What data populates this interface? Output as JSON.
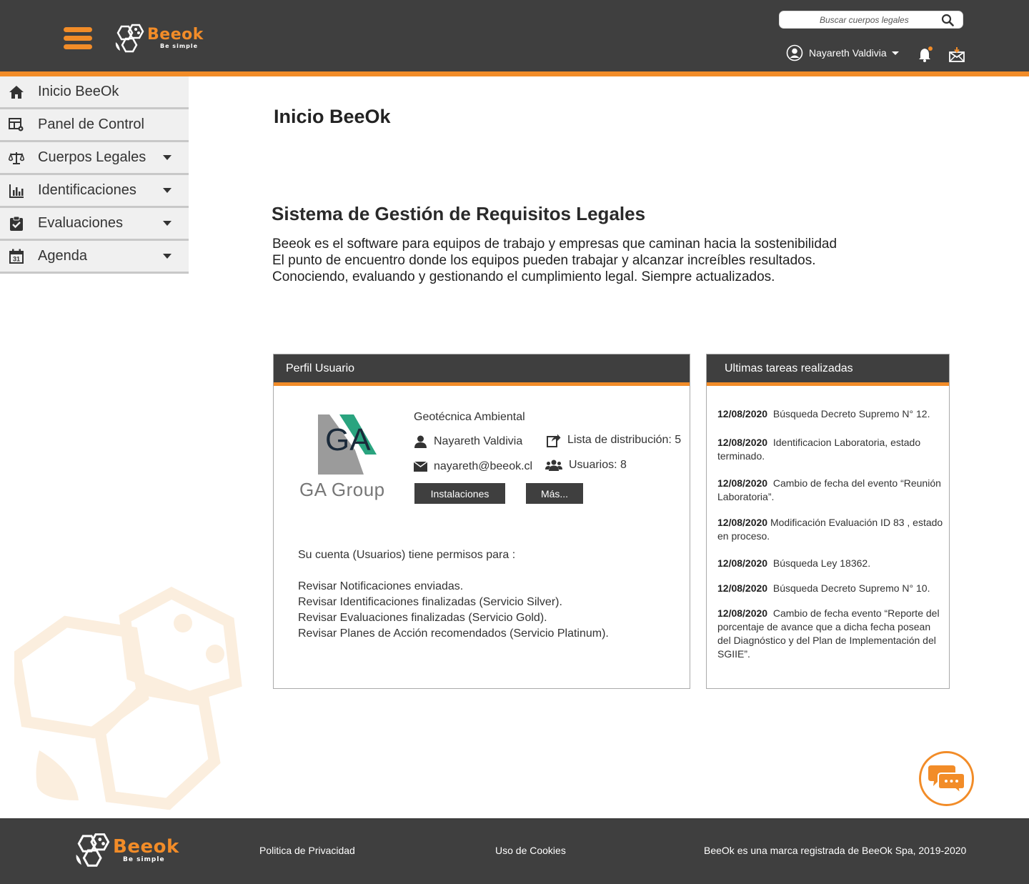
{
  "header": {
    "brand_name": "Beeok",
    "brand_tagline": "Be simple",
    "search_placeholder": "Buscar cuerpos legales",
    "user_name": "Nayareth Valdivia",
    "colors": {
      "bar": "#3f3f3f",
      "accent": "#f28c28"
    },
    "icons": [
      "menu-icon",
      "search-icon",
      "user-icon",
      "bell-icon",
      "mail-icon"
    ]
  },
  "sidebar": {
    "items": [
      {
        "label": "Inicio BeeOk",
        "icon": "home-icon",
        "has_submenu": false
      },
      {
        "label": "Panel de Control",
        "icon": "dashboard-icon",
        "has_submenu": false
      },
      {
        "label": "Cuerpos Legales",
        "icon": "scale-icon",
        "has_submenu": true
      },
      {
        "label": "Identificaciones",
        "icon": "bar-chart-icon",
        "has_submenu": true
      },
      {
        "label": "Evaluaciones",
        "icon": "clipboard-check-icon",
        "has_submenu": true
      },
      {
        "label": "Agenda",
        "icon": "calendar-icon",
        "calendar_day": "31",
        "has_submenu": true
      }
    ]
  },
  "main": {
    "page_title": "Inicio BeeOk",
    "intro_title": "Sistema de Gestión de Requisitos Legales",
    "intro_lines": [
      "Beeok es el software para equipos de trabajo y empresas que caminan hacia la sostenibilidad",
      "El punto de encuentro donde los equipos pueden trabajar y alcanzar increíbles resultados.",
      "Conociendo, evaluando y gestionando el cumplimiento legal. Siempre actualizados."
    ]
  },
  "profile": {
    "header": "Perfil Usuario",
    "logo_letters": "GA",
    "logo_text": "GA Group",
    "company": "Geotécnica Ambiental",
    "user_name": "Nayareth  Valdivia",
    "email": "nayareth@beeok.cl",
    "distribution_list": "Lista de distribución: 5",
    "users": "Usuarios: 8",
    "btn_installations": "Instalaciones",
    "btn_more": "Más...",
    "permissions_intro": "Su cuenta (Usuarios) tiene permisos para :",
    "permissions": [
      "Revisar Notificaciones enviadas.",
      "Revisar Identificaciones finalizadas (Servicio Silver).",
      "Revisar Evaluaciones finalizadas (Servicio Gold).",
      "Revisar Planes de Acción recomendados (Servicio Platinum)."
    ]
  },
  "tasks": {
    "header": "Ultimas tareas realizadas",
    "items": [
      {
        "date": "12/08/2020",
        "text": "Búsqueda Decreto Supremo N° 12."
      },
      {
        "date": "12/08/2020",
        "text": "Identificacion Laboratoria, estado terminado."
      },
      {
        "date": "12/08/2020",
        "text": "Cambio de fecha  del evento “Reunión Laboratoria”."
      },
      {
        "date": "12/08/2020",
        "text": "Modificación Evaluación ID 83 , estado en proceso."
      },
      {
        "date": "12/08/2020",
        "text": "Búsqueda Ley  18362."
      },
      {
        "date": "12/08/2020",
        "text": "Búsqueda Decreto Supremo N° 10."
      },
      {
        "date": "12/08/2020",
        "text": "Cambio de fecha evento “Reporte del porcentaje de avance que a dicha fecha posean del Diagnóstico y del Plan de Implementación del SGIIE”."
      }
    ]
  },
  "footer": {
    "brand_name": "Beeok",
    "brand_tagline": "Be simple",
    "privacy": "Politica de Privacidad",
    "cookies": "Uso de  Cookies",
    "copyright": "BeeOk es una marca registrada de BeeOk Spa, 2019-2020"
  }
}
